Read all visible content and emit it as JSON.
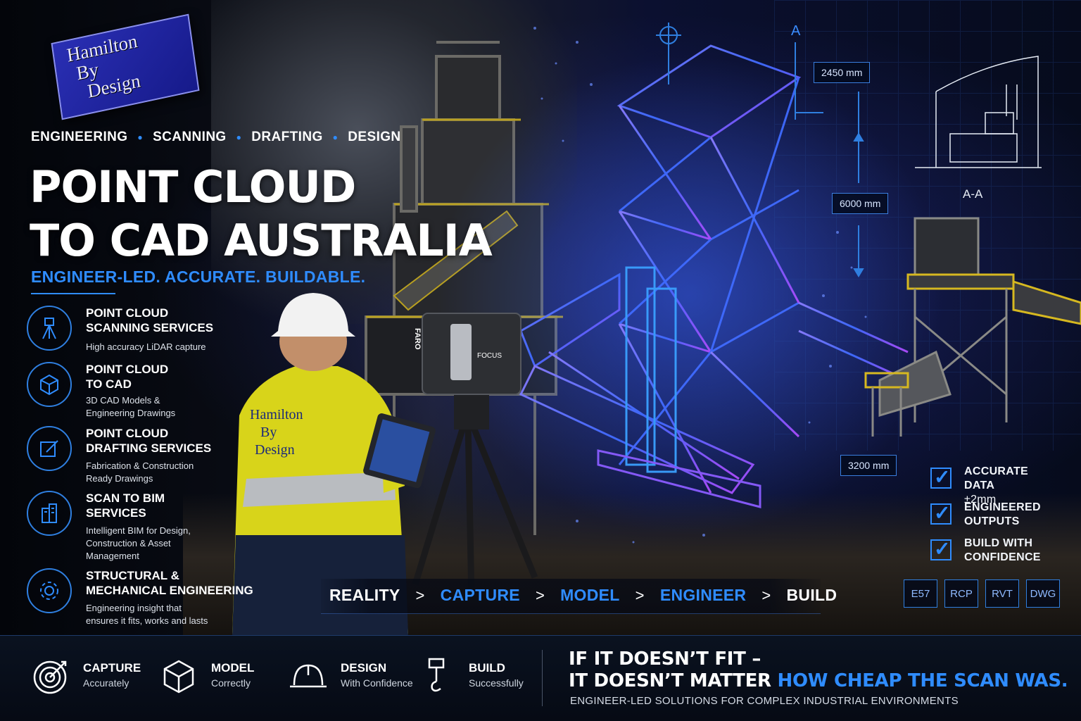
{
  "brand": {
    "logo_lines": [
      "Hamilton",
      "By",
      "Design"
    ],
    "vest_lines": [
      "Hamilton",
      "By",
      "Design"
    ]
  },
  "services_line": [
    "ENGINEERING",
    "SCANNING",
    "DRAFTING",
    "DESIGN"
  ],
  "headline": {
    "line1": "POINT CLOUD",
    "line2": "TO CAD AUSTRALIA"
  },
  "tagline": "ENGINEER-LED. ACCURATE. BUILDABLE.",
  "services": [
    {
      "icon": "tripod-scanner-icon",
      "title": "POINT CLOUD\nSCANNING SERVICES",
      "desc": "High accuracy LiDAR capture"
    },
    {
      "icon": "cube-icon",
      "title": "POINT CLOUD\nTO CAD",
      "desc": "3D CAD Models &\nEngineering Drawings"
    },
    {
      "icon": "pencil-square-icon",
      "title": "POINT CLOUD\nDRAFTING SERVICES",
      "desc": "Fabrication & Construction\nReady Drawings"
    },
    {
      "icon": "building-icon",
      "title": "SCAN TO BIM\nSERVICES",
      "desc": "Intelligent BIM for Design,\nConstruction & Asset\nManagement"
    },
    {
      "icon": "gear-icon",
      "title": "STRUCTURAL &\nMECHANICAL ENGINEERING",
      "desc": "Engineering insight that\nensures it fits, works and lasts"
    }
  ],
  "scanner": {
    "brand": "FARO",
    "model": "FOCUS"
  },
  "dimensions": {
    "width": "2450 mm",
    "height": "6000 mm",
    "depth": "3200 mm",
    "section_marker": "A",
    "section_label": "A-A"
  },
  "checklist": [
    {
      "title": "ACCURATE DATA",
      "sub": "±2mm"
    },
    {
      "title": "ENGINEERED",
      "sub": "OUTPUTS"
    },
    {
      "title": "BUILD WITH",
      "sub": "CONFIDENCE"
    }
  ],
  "formats": [
    "E57",
    "RCP",
    "RVT",
    "DWG"
  ],
  "flow": [
    "REALITY",
    "CAPTURE",
    "MODEL",
    "ENGINEER",
    "BUILD"
  ],
  "steps": [
    {
      "icon": "target-icon",
      "title": "CAPTURE",
      "sub": "Accurately"
    },
    {
      "icon": "cube-icon",
      "title": "MODEL",
      "sub": "Correctly"
    },
    {
      "icon": "hard-hat-icon",
      "title": "DESIGN",
      "sub": "With Confidence"
    },
    {
      "icon": "crane-hook-icon",
      "title": "BUILD",
      "sub": "Successfully"
    }
  ],
  "quote": {
    "line1": "IF IT DOESN’T FIT –",
    "line2_white": "IT DOESN’T MATTER ",
    "line2_blue": "HOW CHEAP THE SCAN WAS.",
    "sub": "ENGINEER-LED SOLUTIONS FOR COMPLEX INDUSTRIAL ENVIRONMENTS"
  },
  "colors": {
    "accent": "#2f8cff",
    "background": "#05070d",
    "vest_yellow": "#e8e020",
    "wireframe": "#5a5cff"
  }
}
